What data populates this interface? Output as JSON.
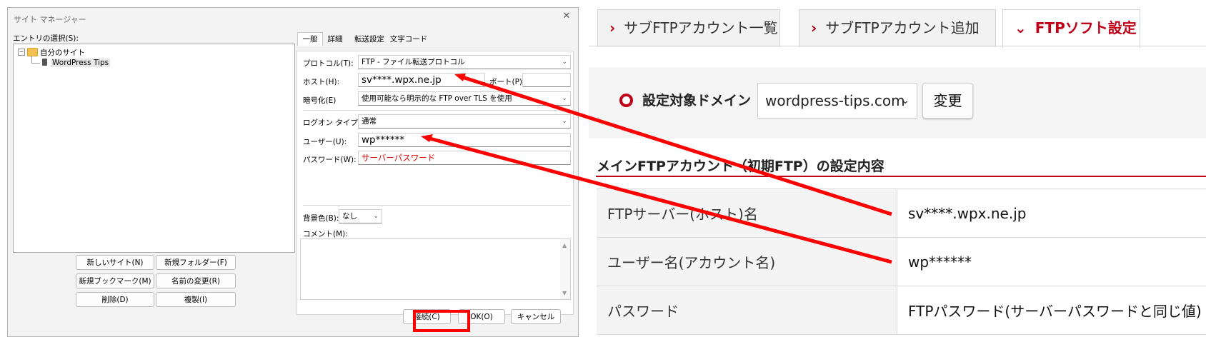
{
  "dialog": {
    "title": "サイト マネージャー",
    "close_glyph": "✕",
    "entry_label": "エントリの選択(S):",
    "tree": [
      {
        "toggle": "−",
        "label": "自分のサイト"
      },
      {
        "label": "WordPress Tips"
      }
    ],
    "left_buttons": [
      "新しいサイト(N)",
      "新規フォルダー(F)",
      "新規ブックマーク(M)",
      "名前の変更(R)",
      "削除(D)",
      "複製(I)"
    ],
    "tabs": [
      "一般",
      "詳細",
      "転送設定",
      "文字コード"
    ],
    "protocol_label": "プロトコル(T):",
    "protocol_value": "FTP - ファイル転送プロトコル",
    "host_label": "ホスト(H):",
    "host_value": "sv****.wpx.ne.jp",
    "port_label": "ポート(P):",
    "port_value": "",
    "encryption_label": "暗号化(E)",
    "encryption_value": "使用可能なら明示的な FTP over TLS を使用",
    "logon_label": "ログオン タイプ(L):",
    "logon_value": "通常",
    "user_label": "ユーザー(U):",
    "user_value": "wp******",
    "password_label": "パスワード(W):",
    "password_value": "サーバーパスワード",
    "bg_label": "背景色(B):",
    "bg_value": "なし",
    "comment_label": "コメント(M):",
    "connect_button": "接続(C)",
    "ok_button": "OK(O)",
    "cancel_button": "キャンセル"
  },
  "web": {
    "tabs": [
      {
        "chevron": "›",
        "label": "サブFTPアカウント一覧"
      },
      {
        "chevron": "›",
        "label": "サブFTPアカウント追加"
      },
      {
        "chevron": "⌄",
        "label": "FTPソフト設定"
      }
    ],
    "domain_label": "設定対象ドメイン",
    "domain_value": "wordpress-tips.com",
    "change_button": "変更",
    "section_title": "メインFTPアカウント（初期FTP）の設定内容",
    "rows": [
      {
        "key": "FTPサーバー(ホスト)名",
        "value": "sv****.wpx.ne.jp"
      },
      {
        "key": "ユーザー名(アカウント名)",
        "value": "wp******"
      },
      {
        "key": "パスワード",
        "value": "FTPパスワード(サーバーパスワードと同じ値)"
      }
    ]
  },
  "colors": {
    "accent_red": "#c00017",
    "annotation_red": "#ff0000",
    "password_text": "#e00000"
  }
}
